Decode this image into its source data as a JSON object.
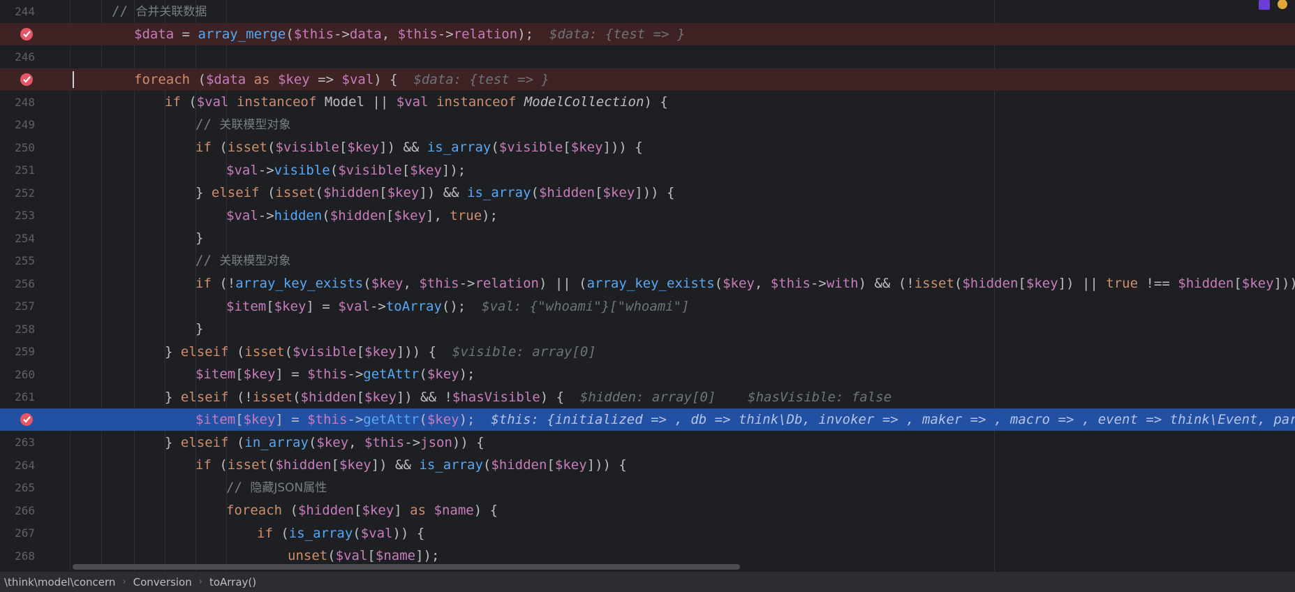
{
  "editor": {
    "lines": [
      {
        "num": "244",
        "bp": false,
        "cur": false,
        "indent": 160,
        "tokens": [
          [
            "cmt-mono",
            "// "
          ],
          [
            "cmt",
            "合并关联数据"
          ]
        ]
      },
      {
        "num": "",
        "bp": true,
        "cur": false,
        "indent": 192,
        "tokens": [
          [
            "var",
            "$data"
          ],
          [
            "cls",
            " = "
          ],
          [
            "fn",
            "array_merge"
          ],
          [
            "cls",
            "("
          ],
          [
            "var",
            "$this"
          ],
          [
            "cls",
            "->"
          ],
          [
            "prop",
            "data"
          ],
          [
            "cls",
            ", "
          ],
          [
            "var",
            "$this"
          ],
          [
            "cls",
            "->"
          ],
          [
            "prop",
            "relation"
          ],
          [
            "cls",
            ");  "
          ],
          [
            "inlay",
            "$data: {test => }"
          ]
        ]
      },
      {
        "num": "246",
        "bp": false,
        "cur": false,
        "indent": 192,
        "tokens": []
      },
      {
        "num": "",
        "bp": true,
        "cur": false,
        "caret": true,
        "indent": 192,
        "tokens": [
          [
            "kw",
            "foreach"
          ],
          [
            "cls",
            " ("
          ],
          [
            "var",
            "$data"
          ],
          [
            "cls",
            " "
          ],
          [
            "kw",
            "as"
          ],
          [
            "cls",
            " "
          ],
          [
            "var",
            "$key"
          ],
          [
            "cls",
            " => "
          ],
          [
            "var",
            "$val"
          ],
          [
            "cls",
            ") {  "
          ],
          [
            "inlay",
            "$data: {test => }"
          ]
        ]
      },
      {
        "num": "248",
        "bp": false,
        "cur": false,
        "indent": 236,
        "tokens": [
          [
            "kw",
            "if"
          ],
          [
            "cls",
            " ("
          ],
          [
            "var",
            "$val"
          ],
          [
            "cls",
            " "
          ],
          [
            "kw",
            "instanceof"
          ],
          [
            "cls",
            " Model || "
          ],
          [
            "var",
            "$val"
          ],
          [
            "cls",
            " "
          ],
          [
            "kw",
            "instanceof"
          ],
          [
            "cls",
            " "
          ],
          [
            "italic-cls",
            "ModelCollection"
          ],
          [
            "cls",
            ") {"
          ]
        ]
      },
      {
        "num": "249",
        "bp": false,
        "cur": false,
        "indent": 280,
        "tokens": [
          [
            "cmt-mono",
            "// "
          ],
          [
            "cmt",
            "关联模型对象"
          ]
        ]
      },
      {
        "num": "250",
        "bp": false,
        "cur": false,
        "indent": 280,
        "tokens": [
          [
            "kw",
            "if"
          ],
          [
            "cls",
            " ("
          ],
          [
            "kw",
            "isset"
          ],
          [
            "cls",
            "("
          ],
          [
            "var",
            "$visible"
          ],
          [
            "cls",
            "["
          ],
          [
            "var",
            "$key"
          ],
          [
            "cls",
            "]) && "
          ],
          [
            "fn",
            "is_array"
          ],
          [
            "cls",
            "("
          ],
          [
            "var",
            "$visible"
          ],
          [
            "cls",
            "["
          ],
          [
            "var",
            "$key"
          ],
          [
            "cls",
            "])) {"
          ]
        ]
      },
      {
        "num": "251",
        "bp": false,
        "cur": false,
        "indent": 324,
        "tokens": [
          [
            "var",
            "$val"
          ],
          [
            "cls",
            "->"
          ],
          [
            "fn",
            "visible"
          ],
          [
            "cls",
            "("
          ],
          [
            "var",
            "$visible"
          ],
          [
            "cls",
            "["
          ],
          [
            "var",
            "$key"
          ],
          [
            "cls",
            "]);"
          ]
        ]
      },
      {
        "num": "252",
        "bp": false,
        "cur": false,
        "indent": 280,
        "tokens": [
          [
            "cls",
            "} "
          ],
          [
            "kw",
            "elseif"
          ],
          [
            "cls",
            " ("
          ],
          [
            "kw",
            "isset"
          ],
          [
            "cls",
            "("
          ],
          [
            "var",
            "$hidden"
          ],
          [
            "cls",
            "["
          ],
          [
            "var",
            "$key"
          ],
          [
            "cls",
            "]) && "
          ],
          [
            "fn",
            "is_array"
          ],
          [
            "cls",
            "("
          ],
          [
            "var",
            "$hidden"
          ],
          [
            "cls",
            "["
          ],
          [
            "var",
            "$key"
          ],
          [
            "cls",
            "])) {"
          ]
        ]
      },
      {
        "num": "253",
        "bp": false,
        "cur": false,
        "indent": 324,
        "tokens": [
          [
            "var",
            "$val"
          ],
          [
            "cls",
            "->"
          ],
          [
            "fn",
            "hidden"
          ],
          [
            "cls",
            "("
          ],
          [
            "var",
            "$hidden"
          ],
          [
            "cls",
            "["
          ],
          [
            "var",
            "$key"
          ],
          [
            "cls",
            "], "
          ],
          [
            "kw",
            "true"
          ],
          [
            "cls",
            ");"
          ]
        ]
      },
      {
        "num": "254",
        "bp": false,
        "cur": false,
        "indent": 280,
        "tokens": [
          [
            "cls",
            "}"
          ]
        ]
      },
      {
        "num": "255",
        "bp": false,
        "cur": false,
        "indent": 280,
        "tokens": [
          [
            "cmt-mono",
            "// "
          ],
          [
            "cmt",
            "关联模型对象"
          ]
        ]
      },
      {
        "num": "256",
        "bp": false,
        "cur": false,
        "indent": 280,
        "tokens": [
          [
            "kw",
            "if"
          ],
          [
            "cls",
            " (!"
          ],
          [
            "fn",
            "array_key_exists"
          ],
          [
            "cls",
            "("
          ],
          [
            "var",
            "$key"
          ],
          [
            "cls",
            ", "
          ],
          [
            "var",
            "$this"
          ],
          [
            "cls",
            "->"
          ],
          [
            "prop",
            "relation"
          ],
          [
            "cls",
            ") || ("
          ],
          [
            "fn",
            "array_key_exists"
          ],
          [
            "cls",
            "("
          ],
          [
            "var",
            "$key"
          ],
          [
            "cls",
            ", "
          ],
          [
            "var",
            "$this"
          ],
          [
            "cls",
            "->"
          ],
          [
            "prop",
            "with"
          ],
          [
            "cls",
            ") && (!"
          ],
          [
            "kw",
            "isset"
          ],
          [
            "cls",
            "("
          ],
          [
            "var",
            "$hidden"
          ],
          [
            "cls",
            "["
          ],
          [
            "var",
            "$key"
          ],
          [
            "cls",
            "]) || "
          ],
          [
            "kw",
            "true"
          ],
          [
            "cls",
            " !== "
          ],
          [
            "var",
            "$hidden"
          ],
          [
            "cls",
            "["
          ],
          [
            "var",
            "$key"
          ],
          [
            "cls",
            "]))) {"
          ]
        ]
      },
      {
        "num": "257",
        "bp": false,
        "cur": false,
        "indent": 324,
        "tokens": [
          [
            "var",
            "$item"
          ],
          [
            "cls",
            "["
          ],
          [
            "var",
            "$key"
          ],
          [
            "cls",
            "] = "
          ],
          [
            "var",
            "$val"
          ],
          [
            "cls",
            "->"
          ],
          [
            "fn",
            "toArray"
          ],
          [
            "cls",
            "();  "
          ],
          [
            "inlay",
            "$val: {\"whoami\"}[\"whoami\"]"
          ]
        ]
      },
      {
        "num": "258",
        "bp": false,
        "cur": false,
        "indent": 280,
        "tokens": [
          [
            "cls",
            "}"
          ]
        ]
      },
      {
        "num": "259",
        "bp": false,
        "cur": false,
        "indent": 236,
        "tokens": [
          [
            "cls",
            "} "
          ],
          [
            "kw",
            "elseif"
          ],
          [
            "cls",
            " ("
          ],
          [
            "kw",
            "isset"
          ],
          [
            "cls",
            "("
          ],
          [
            "var",
            "$visible"
          ],
          [
            "cls",
            "["
          ],
          [
            "var",
            "$key"
          ],
          [
            "cls",
            "])) {  "
          ],
          [
            "inlay",
            "$visible: array[0]"
          ]
        ]
      },
      {
        "num": "260",
        "bp": false,
        "cur": false,
        "indent": 280,
        "tokens": [
          [
            "var",
            "$item"
          ],
          [
            "cls",
            "["
          ],
          [
            "var",
            "$key"
          ],
          [
            "cls",
            "] = "
          ],
          [
            "var",
            "$this"
          ],
          [
            "cls",
            "->"
          ],
          [
            "fn",
            "getAttr"
          ],
          [
            "cls",
            "("
          ],
          [
            "var",
            "$key"
          ],
          [
            "cls",
            ");"
          ]
        ]
      },
      {
        "num": "261",
        "bp": false,
        "cur": false,
        "indent": 236,
        "tokens": [
          [
            "cls",
            "} "
          ],
          [
            "kw",
            "elseif"
          ],
          [
            "cls",
            " (!"
          ],
          [
            "kw",
            "isset"
          ],
          [
            "cls",
            "("
          ],
          [
            "var",
            "$hidden"
          ],
          [
            "cls",
            "["
          ],
          [
            "var",
            "$key"
          ],
          [
            "cls",
            "]) && !"
          ],
          [
            "var",
            "$hasVisible"
          ],
          [
            "cls",
            ") {  "
          ],
          [
            "inlay",
            "$hidden: array[0]    $hasVisible: false"
          ]
        ]
      },
      {
        "num": "",
        "bp": true,
        "cur": true,
        "indent": 280,
        "tokens": [
          [
            "var",
            "$item"
          ],
          [
            "cls",
            "["
          ],
          [
            "var",
            "$key"
          ],
          [
            "cls",
            "] = "
          ],
          [
            "var",
            "$this"
          ],
          [
            "cls",
            "->"
          ],
          [
            "fn",
            "getAttr"
          ],
          [
            "cls",
            "("
          ],
          [
            "var",
            "$key"
          ],
          [
            "cls",
            ");  "
          ],
          [
            "inlay",
            "$this: {initialized => , db => think\\Db, invoker => , maker => , macro => , event => think\\Event, parent ="
          ]
        ]
      },
      {
        "num": "263",
        "bp": false,
        "cur": false,
        "indent": 236,
        "tokens": [
          [
            "cls",
            "} "
          ],
          [
            "kw",
            "elseif"
          ],
          [
            "cls",
            " ("
          ],
          [
            "fn",
            "in_array"
          ],
          [
            "cls",
            "("
          ],
          [
            "var",
            "$key"
          ],
          [
            "cls",
            ", "
          ],
          [
            "var",
            "$this"
          ],
          [
            "cls",
            "->"
          ],
          [
            "prop",
            "json"
          ],
          [
            "cls",
            ")) {"
          ]
        ]
      },
      {
        "num": "264",
        "bp": false,
        "cur": false,
        "indent": 280,
        "tokens": [
          [
            "kw",
            "if"
          ],
          [
            "cls",
            " ("
          ],
          [
            "kw",
            "isset"
          ],
          [
            "cls",
            "("
          ],
          [
            "var",
            "$hidden"
          ],
          [
            "cls",
            "["
          ],
          [
            "var",
            "$key"
          ],
          [
            "cls",
            "]) && "
          ],
          [
            "fn",
            "is_array"
          ],
          [
            "cls",
            "("
          ],
          [
            "var",
            "$hidden"
          ],
          [
            "cls",
            "["
          ],
          [
            "var",
            "$key"
          ],
          [
            "cls",
            "])) {"
          ]
        ]
      },
      {
        "num": "265",
        "bp": false,
        "cur": false,
        "indent": 324,
        "tokens": [
          [
            "cmt-mono",
            "// "
          ],
          [
            "cmt",
            "隐藏JSON属性"
          ]
        ]
      },
      {
        "num": "266",
        "bp": false,
        "cur": false,
        "indent": 324,
        "tokens": [
          [
            "kw",
            "foreach"
          ],
          [
            "cls",
            " ("
          ],
          [
            "var",
            "$hidden"
          ],
          [
            "cls",
            "["
          ],
          [
            "var",
            "$key"
          ],
          [
            "cls",
            "] "
          ],
          [
            "kw",
            "as"
          ],
          [
            "cls",
            " "
          ],
          [
            "var",
            "$name"
          ],
          [
            "cls",
            ") {"
          ]
        ]
      },
      {
        "num": "267",
        "bp": false,
        "cur": false,
        "indent": 368,
        "tokens": [
          [
            "kw",
            "if"
          ],
          [
            "cls",
            " ("
          ],
          [
            "fn",
            "is_array"
          ],
          [
            "cls",
            "("
          ],
          [
            "var",
            "$val"
          ],
          [
            "cls",
            ")) {"
          ]
        ]
      },
      {
        "num": "268",
        "bp": false,
        "cur": false,
        "indent": 412,
        "tokens": [
          [
            "kw",
            "unset"
          ],
          [
            "cls",
            "("
          ],
          [
            "var",
            "$val"
          ],
          [
            "cls",
            "["
          ],
          [
            "var",
            "$name"
          ],
          [
            "cls",
            "]);"
          ]
        ]
      }
    ]
  },
  "breadcrumb": {
    "items": [
      "\\think\\model\\concern",
      "Conversion",
      "toArray()"
    ]
  },
  "colors": {
    "breakpoint_line": "#3e2224",
    "current_line": "#2250a3",
    "keyword": "#cf8e6d",
    "variable": "#c77dbb",
    "function": "#56a8f5"
  }
}
